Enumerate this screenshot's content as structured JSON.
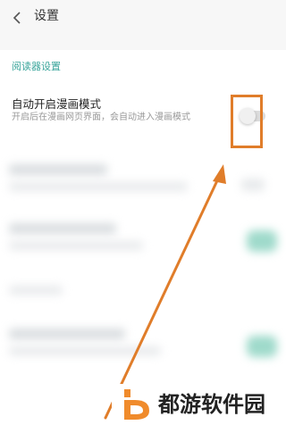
{
  "header": {
    "title": "设置"
  },
  "section": {
    "label": "阅读器设置"
  },
  "setting": {
    "title": "自动开启漫画模式",
    "description": "开启后在漫画网页界面，会自动进入漫画模式",
    "toggle_on": false
  },
  "colors": {
    "accent": "#3aa59b",
    "highlight": "#e07d2a",
    "watermark_logo": "#f08b2c"
  },
  "watermark": {
    "text": "都游软件园"
  }
}
